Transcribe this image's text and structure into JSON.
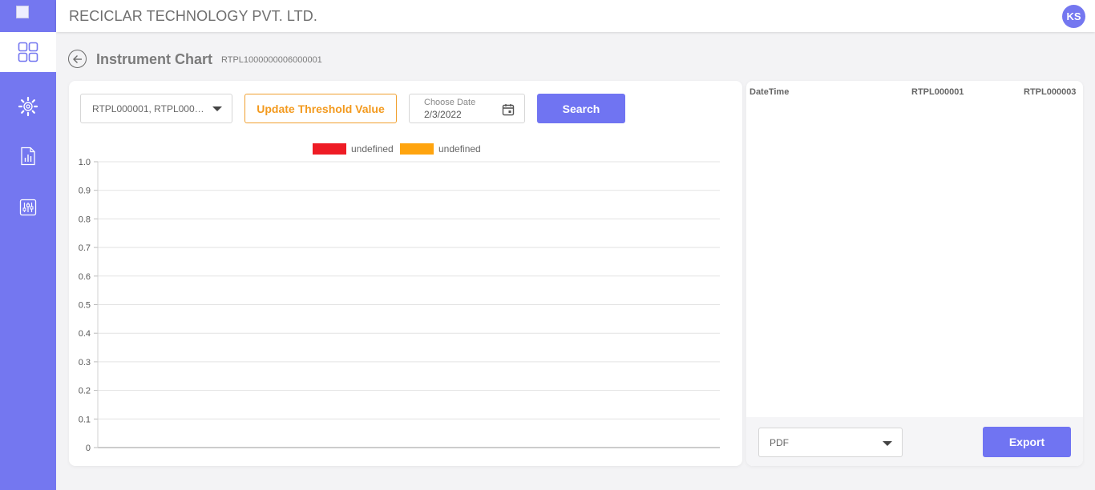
{
  "header": {
    "company": "RECICLAR TECHNOLOGY PVT. LTD.",
    "avatar_initials": "KS"
  },
  "sidebar": {
    "items": [
      {
        "icon": "dashboard-grid-icon",
        "active": true
      },
      {
        "icon": "gear-settings-icon",
        "active": false
      },
      {
        "icon": "report-chart-icon",
        "active": false
      },
      {
        "icon": "sliders-icon",
        "active": false
      }
    ]
  },
  "page": {
    "title": "Instrument Chart",
    "instrument_id": "RTPL1000000006000001"
  },
  "controls": {
    "instrument_select_value": "RTPL000001, RTPL000…",
    "threshold_button": "Update Threshold Value",
    "date_label": "Choose Date",
    "date_value": "2/3/2022",
    "search_button": "Search"
  },
  "chart_data": {
    "type": "line",
    "series": [
      {
        "name": "undefined",
        "color": "#ee1c25",
        "values": []
      },
      {
        "name": "undefined",
        "color": "#ffa40e",
        "values": []
      }
    ],
    "y_ticks": [
      "1.0",
      "0.9",
      "0.8",
      "0.7",
      "0.6",
      "0.5",
      "0.4",
      "0.3",
      "0.2",
      "0.1",
      "0"
    ],
    "ylim": [
      0,
      1
    ],
    "grid": true,
    "legend": "top-center"
  },
  "table": {
    "columns": [
      "DateTime",
      "RTPL000001",
      "RTPL000003"
    ],
    "rows": []
  },
  "export": {
    "format_value": "PDF",
    "button": "Export"
  },
  "colors": {
    "accent": "#7074f2",
    "sidebar": "#7477f0",
    "warning": "#f39a1e"
  }
}
